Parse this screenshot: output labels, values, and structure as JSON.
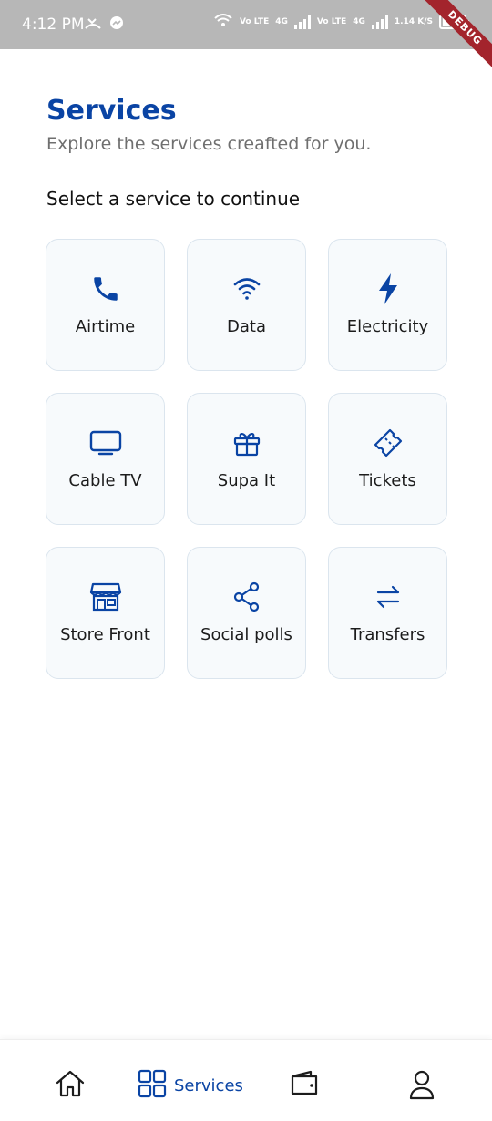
{
  "status_bar": {
    "time": "4:12 PM",
    "network_labels": [
      "Vo LTE",
      "4G",
      "Vo LTE",
      "4G"
    ],
    "speed": "1.14 K/S",
    "debug_banner": "DEBUG"
  },
  "header": {
    "title": "Services",
    "subtitle": "Explore the services creafted for you.",
    "section_heading": "Select a service to continue"
  },
  "services": [
    {
      "label": "Airtime",
      "icon": "phone-icon"
    },
    {
      "label": "Data",
      "icon": "wifi-icon"
    },
    {
      "label": "Electricity",
      "icon": "lightning-icon"
    },
    {
      "label": "Cable TV",
      "icon": "tv-icon"
    },
    {
      "label": "Supa It",
      "icon": "gift-icon"
    },
    {
      "label": "Tickets",
      "icon": "ticket-icon"
    },
    {
      "label": "Store Front",
      "icon": "store-icon"
    },
    {
      "label": "Social polls",
      "icon": "share-icon"
    },
    {
      "label": "Transfers",
      "icon": "transfer-arrows-icon"
    }
  ],
  "bottom_nav": {
    "items": [
      {
        "icon": "home-icon",
        "label": ""
      },
      {
        "icon": "grid-icon",
        "label": "Services",
        "active": true
      },
      {
        "icon": "wallet-icon",
        "label": ""
      },
      {
        "icon": "user-icon",
        "label": ""
      }
    ]
  },
  "colors": {
    "accent": "#0a44a4",
    "card_background": "#f7fafc",
    "card_border": "#dbe5ee",
    "status_bar": "#b7b7b7"
  }
}
